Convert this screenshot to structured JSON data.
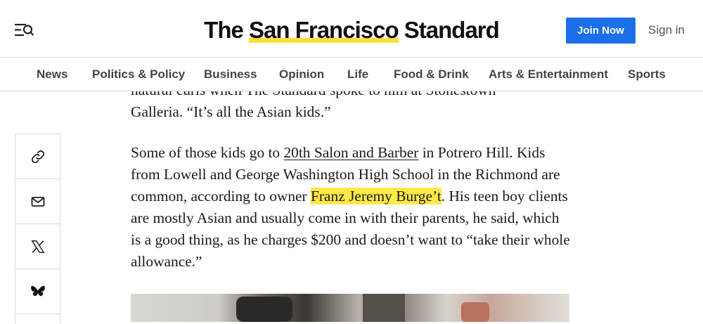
{
  "header": {
    "logo_prefix": "The ",
    "logo_highlight": "San Francisco",
    "logo_suffix": " Standard",
    "join_label": "Join Now",
    "signin_label": "Sign in"
  },
  "nav": {
    "items": [
      "News",
      "Politics & Policy",
      "Business",
      "Opinion",
      "Life",
      "Food & Drink",
      "Arts & Entertainment",
      "Sports"
    ]
  },
  "share": {
    "icons": [
      "link-icon",
      "mail-icon",
      "x-icon",
      "bluesky-icon"
    ]
  },
  "article": {
    "p1_line1": "natural curls when The Standard spoke to him at Stonestown",
    "p1_line2": "Galleria. “It’s all the Asian kids.”",
    "p2_a": "Some of those kids go to ",
    "p2_link": "20th Salon and Barber",
    "p2_b": " in Potrero Hill. Kids from Lowell and George Washington High School in the Richmond are common, according to owner ",
    "p2_highlight": "Franz Jeremy Burge’t",
    "p2_c": ". His teen boy clients are mostly Asian and usually come in with their parents, he said, which is a good thing, as he charges $200 and doesn’t want to “take their whole allowance.”"
  },
  "colors": {
    "accent_blue": "#1c6fe8",
    "highlight_yellow": "#fde947"
  }
}
